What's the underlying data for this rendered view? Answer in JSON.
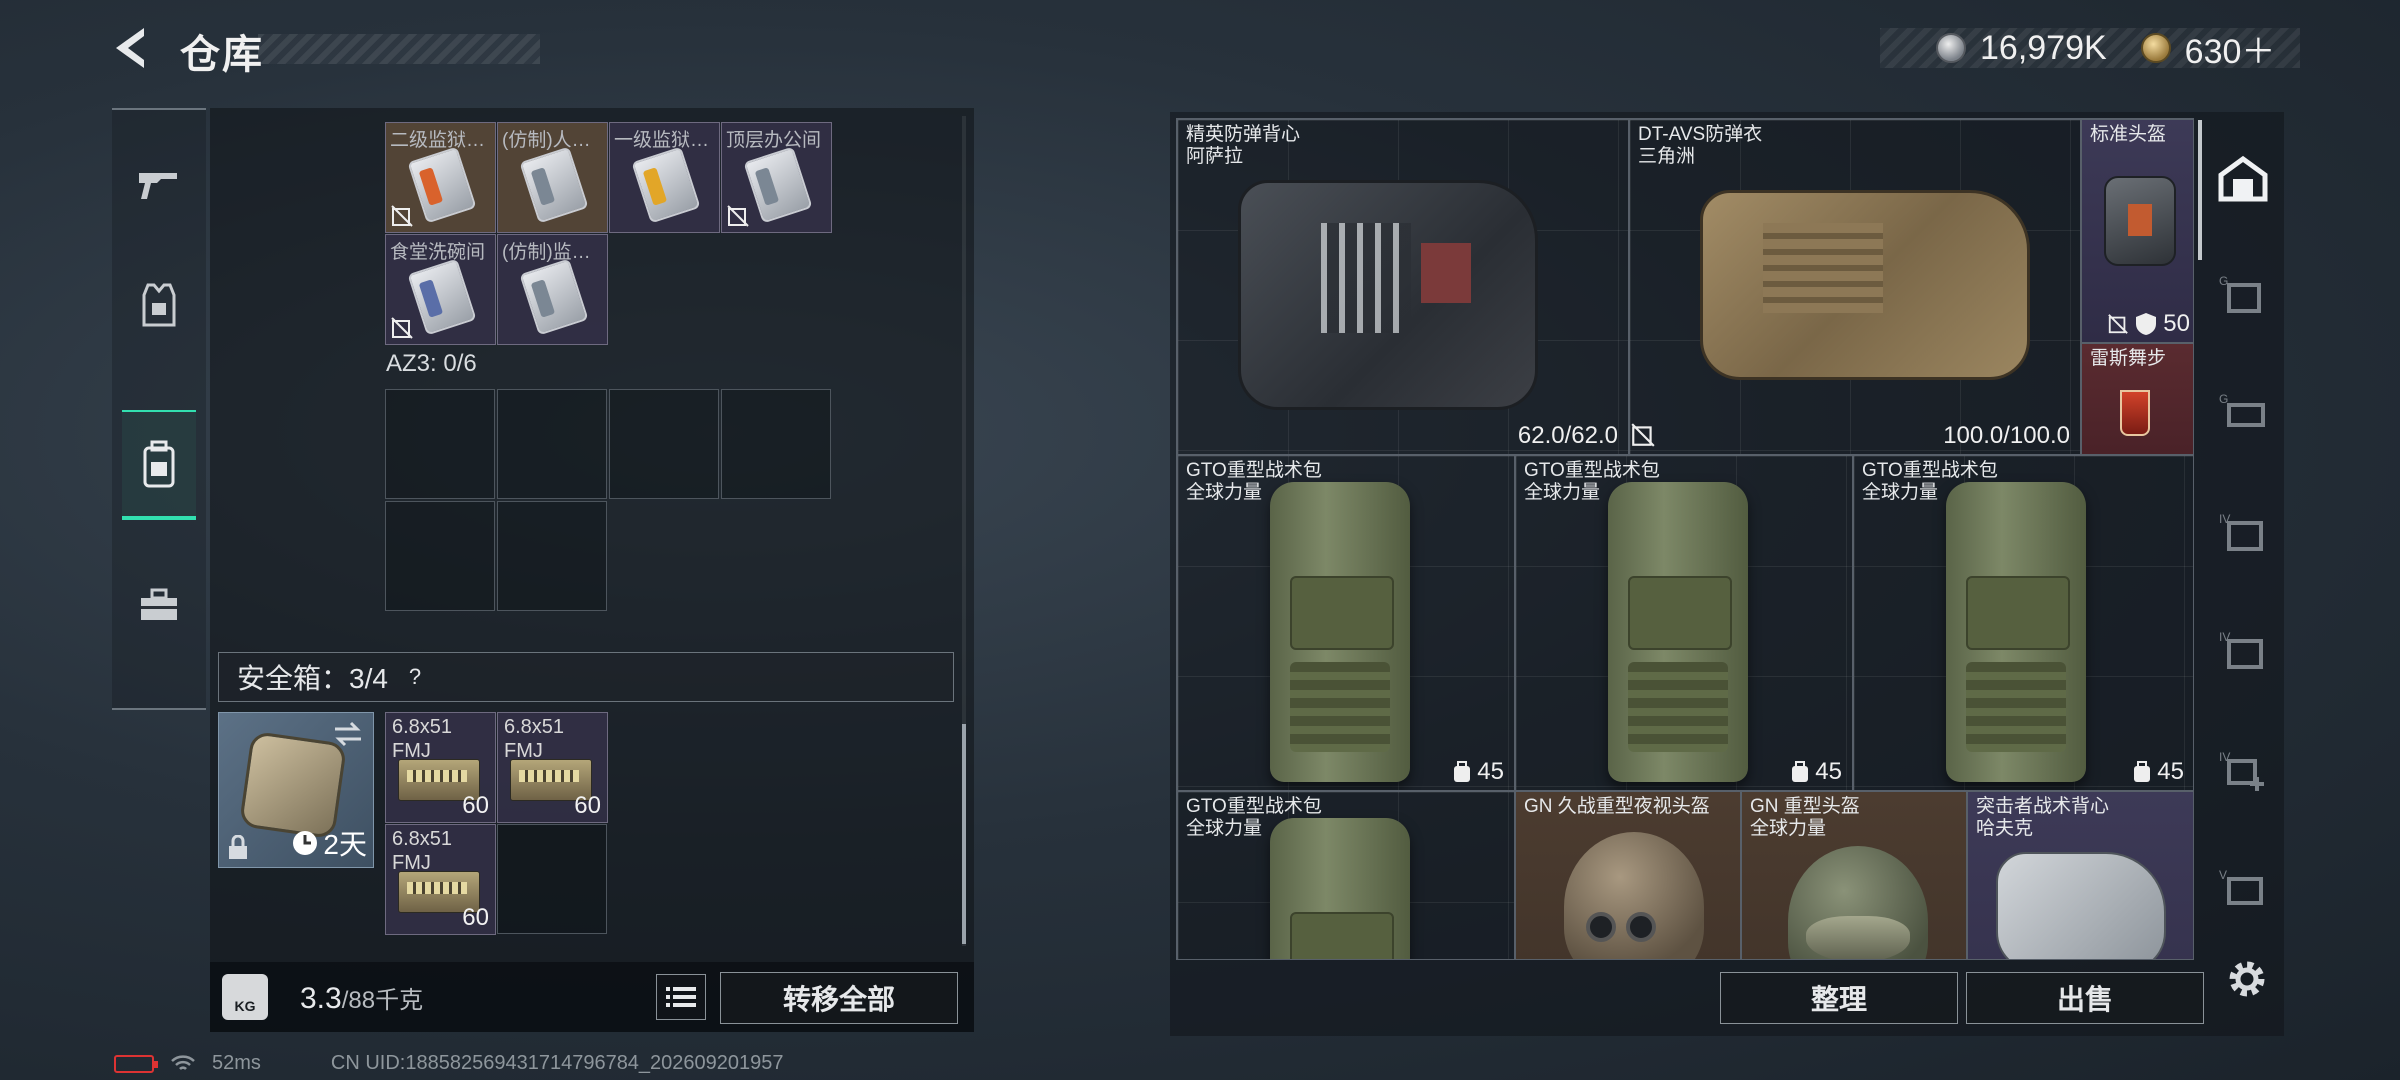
{
  "header": {
    "title": "仓库",
    "currency": {
      "silver": "16,979K",
      "premium": "630＋"
    }
  },
  "left_rail": {
    "tabs": [
      {
        "icon": "gun-icon"
      },
      {
        "icon": "vest-icon"
      },
      {
        "icon": "backpack-icon",
        "active": true
      },
      {
        "icon": "toolbox-icon"
      }
    ]
  },
  "keycards": [
    {
      "name": "二级监狱…"
    },
    {
      "name": "(仿制)人…"
    },
    {
      "name": "一级监狱…"
    },
    {
      "name": "顶层办公间"
    },
    {
      "name": "食堂洗碗间"
    },
    {
      "name": "(仿制)监…"
    }
  ],
  "az3": {
    "label": "AZ3: 0/6"
  },
  "safebox": {
    "label": "安全箱：3/4",
    "help": "?",
    "timer": "2天",
    "ammo": [
      {
        "name": "6.8x51",
        "sub": "FMJ",
        "qty": "60"
      },
      {
        "name": "6.8x51",
        "sub": "FMJ",
        "qty": "60"
      },
      {
        "name": "6.8x51",
        "sub": "FMJ",
        "qty": "60"
      }
    ]
  },
  "weight": {
    "current": "3.3",
    "capacity": "/88千克",
    "icon_label": "KG"
  },
  "buttons": {
    "transfer_all": "转移全部",
    "sort": "整理",
    "sell": "出售"
  },
  "status": {
    "ping": "52ms",
    "uid": "CN UID:18858256943171479678​4_202609201957"
  },
  "equipment": {
    "vest1": {
      "name": "精英防弹背心",
      "brand": "阿萨拉",
      "durability": "62.0/62.0"
    },
    "vest2": {
      "name": "DT-AVS防弹衣",
      "brand": "三角洲",
      "durability": "100.0/100.0"
    },
    "helmet": {
      "name": "标准头盔",
      "value": "50"
    },
    "drink": {
      "name": "雷斯舞步"
    },
    "packs": [
      {
        "name": "GTO重型战术包",
        "brand": "全球力量",
        "cap": "45"
      },
      {
        "name": "GTO重型战术包",
        "brand": "全球力量",
        "cap": "45"
      },
      {
        "name": "GTO重型战术包",
        "brand": "全球力量",
        "cap": "45"
      },
      {
        "name": "GTO重型战术包",
        "brand": "全球力量"
      }
    ],
    "helmets_row": [
      {
        "name": "GN 久战重型夜视头盔"
      },
      {
        "name": "GN 重型头盔",
        "brand": "全球力量"
      },
      {
        "name": "突击者战术背心",
        "brand": "哈夫克"
      }
    ]
  },
  "right_rail": {
    "items": [
      {
        "icon": "stash-home-icon",
        "active": true
      },
      {
        "label": "G",
        "icon": "stash-expansion-icon"
      },
      {
        "label": "G",
        "icon": "stash-expansion-icon"
      },
      {
        "label": "IV",
        "icon": "stash-expansion-icon"
      },
      {
        "label": "IV",
        "icon": "stash-expansion-icon"
      },
      {
        "label": "IV",
        "icon": "stash-add-icon"
      },
      {
        "label": "V",
        "icon": "stash-expansion-icon"
      }
    ]
  }
}
